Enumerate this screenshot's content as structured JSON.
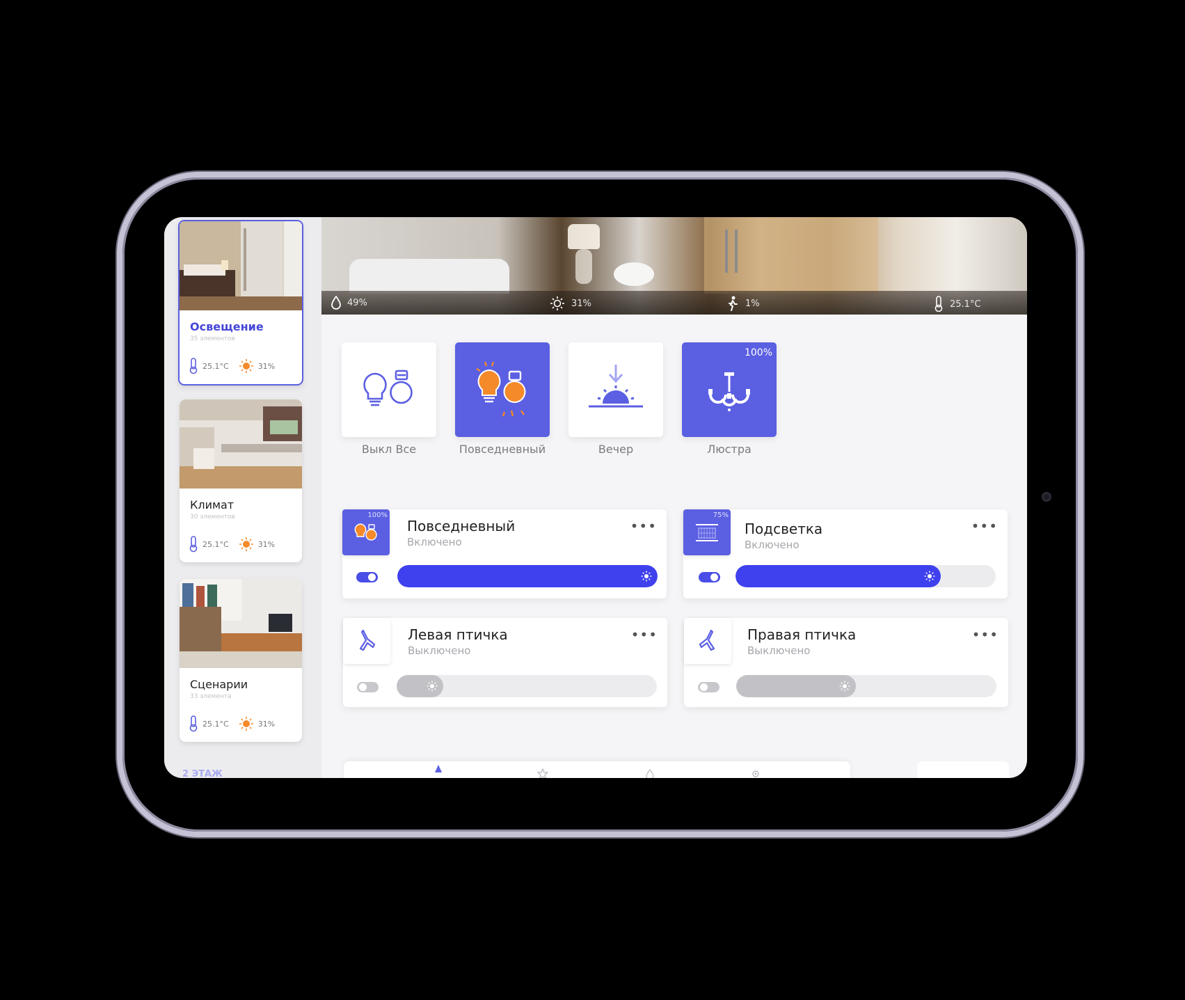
{
  "rooms": [
    {
      "title": "Освещение",
      "subtitle": "35 элементов",
      "temp": "25.1°C",
      "light": "31%",
      "active": true
    },
    {
      "title": "Климат",
      "subtitle": "30 элементов",
      "temp": "25.1°C",
      "light": "31%",
      "active": false
    },
    {
      "title": "Сценарии",
      "subtitle": "33 элемента",
      "temp": "25.1°C",
      "light": "31%",
      "active": false
    }
  ],
  "floor_label": "2 ЭТАЖ",
  "header_stats": {
    "humidity": "49%",
    "illumination": "31%",
    "motion": "1%",
    "temperature": "25.1°C"
  },
  "scenes": [
    {
      "label": "Выкл Все",
      "icon": "bulbs-outline-icon",
      "on": false
    },
    {
      "label": "Повседневный",
      "icon": "bulbs-orange-icon",
      "on": true
    },
    {
      "label": "Вечер",
      "icon": "sunset-icon",
      "on": false
    },
    {
      "label": "Люстра",
      "icon": "chandelier-icon",
      "on": true,
      "percent": "100%"
    }
  ],
  "devices": [
    {
      "title": "Повседневный",
      "status": "Включено",
      "icon": "bulbs-orange-icon",
      "percent": "100%",
      "on": true,
      "level": 1.0
    },
    {
      "title": "Подсветка",
      "status": "Включено",
      "icon": "led-panel-icon",
      "percent": "75%",
      "on": true,
      "level": 0.79
    },
    {
      "title": "Левая птичка",
      "status": "Выключено",
      "icon": "bird-lamp-icon",
      "on": false,
      "level": 0.18
    },
    {
      "title": "Правая птичка",
      "status": "Выключено",
      "icon": "bird-lamp-icon",
      "on": false,
      "level": 0.46
    }
  ],
  "colors": {
    "accent": "#5b5fe2",
    "slider_on": "#3f41ee",
    "orange": "#f48a2a",
    "off": "#c2c2c6"
  }
}
